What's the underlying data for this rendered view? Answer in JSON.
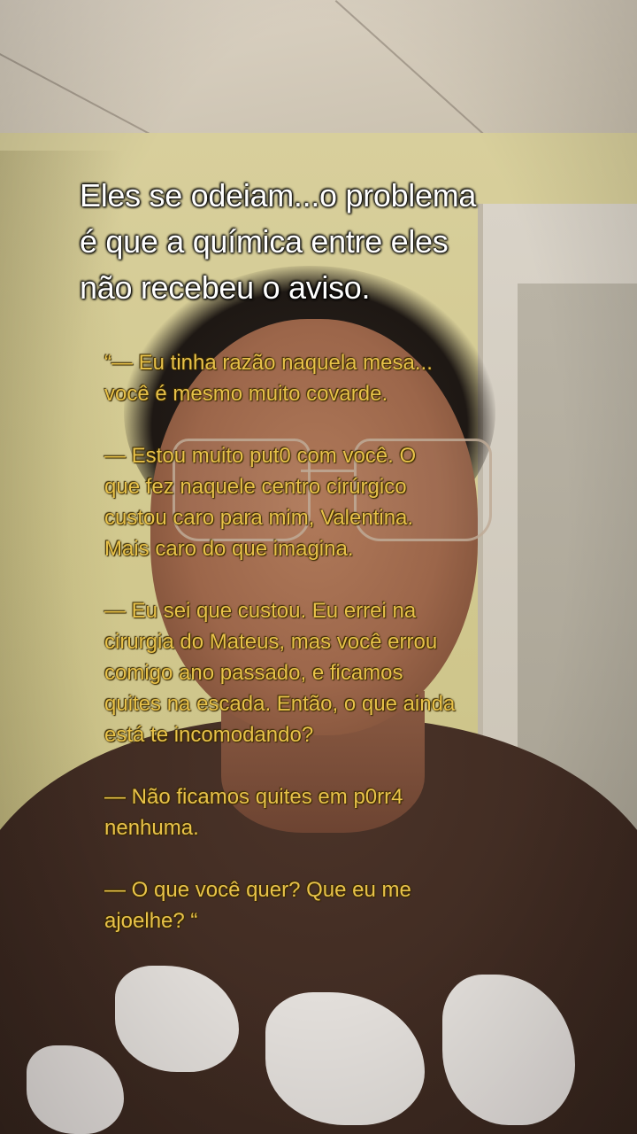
{
  "headline": {
    "lines": [
      "Eles se odeiam...o problema",
      "é que a química entre eles",
      "não recebeu o aviso."
    ]
  },
  "quote": {
    "paragraphs": [
      [
        "“— Eu tinha razão naquela mesa...",
        "você é mesmo muito covarde."
      ],
      [
        " — Estou muito put0 com você.  O",
        "que fez naquele centro cirúrgico",
        "custou caro para mim, Valentina.",
        "Mais caro do que imagina."
      ],
      [
        "— Eu sei que custou. Eu errei na",
        "cirurgia do Mateus, mas você errou",
        "comigo ano passado, e ficamos",
        "quites na escada. Então, o que ainda",
        "está te incomodando?"
      ],
      [
        "— Não ficamos quites em p0rr4",
        "nenhuma."
      ],
      [
        " — O que você quer? Que eu me",
        "ajoelhe? “"
      ]
    ]
  },
  "colors": {
    "headline_text": "#ffffff",
    "quote_text": "#e8c24a"
  }
}
